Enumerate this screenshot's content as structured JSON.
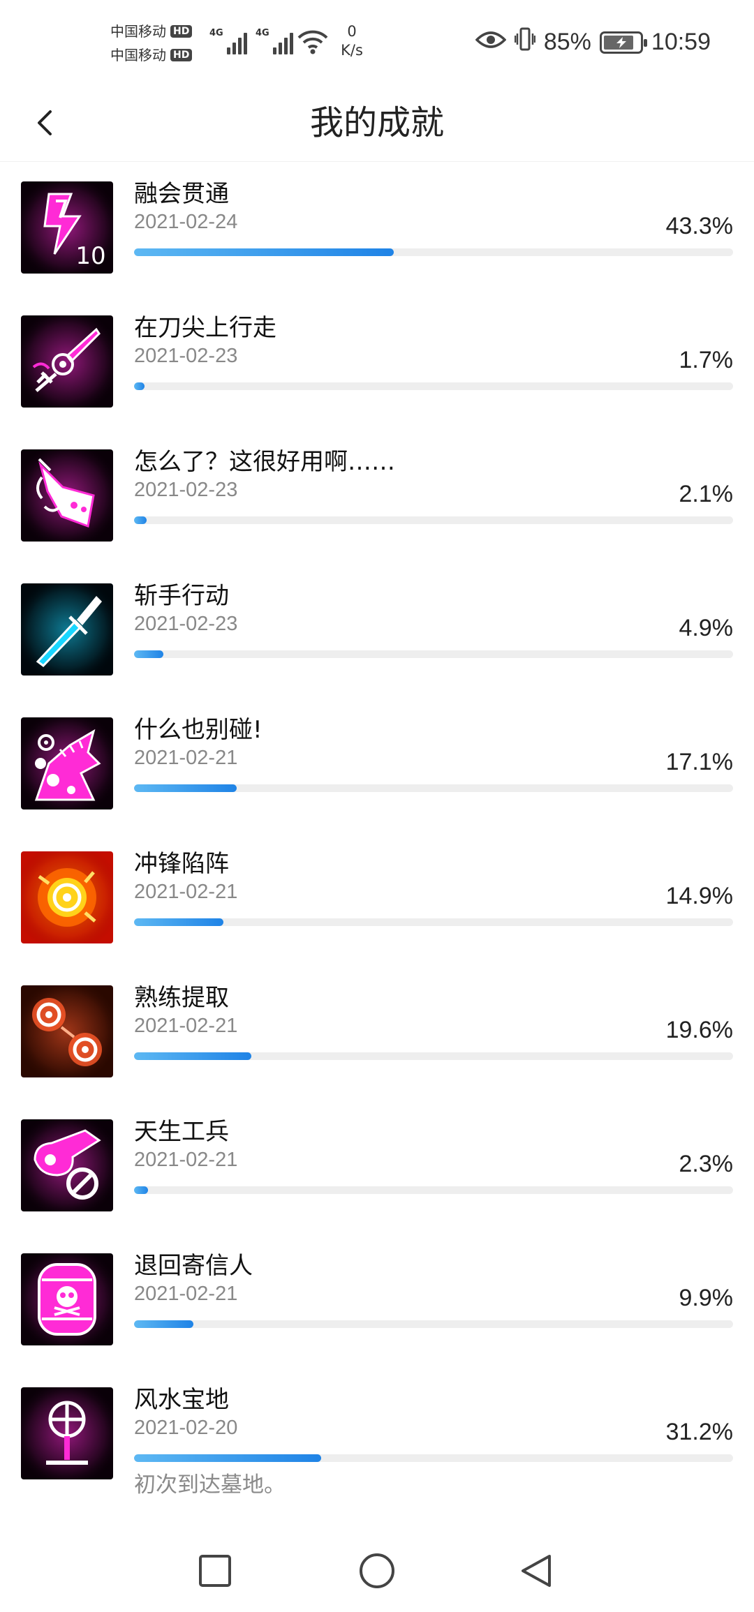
{
  "status_bar": {
    "carrier1": "中国移动",
    "carrier2": "中国移动",
    "hd": "HD",
    "net_tag": "4G",
    "speed_value": "0",
    "speed_unit": "K/s",
    "battery": "85%",
    "time": "10:59"
  },
  "header": {
    "title": "我的成就"
  },
  "achievements": [
    {
      "name": "融会贯通",
      "date": "2021-02-24",
      "percent_label": "43.3%",
      "progress": 0.433,
      "badge": "10",
      "icon": "lightning-icon",
      "color": "#ff2bd6"
    },
    {
      "name": "在刀尖上行走",
      "date": "2021-02-23",
      "percent_label": "1.7%",
      "progress": 0.017,
      "icon": "knife-rose-icon",
      "color": "#ff2bd6"
    },
    {
      "name": "怎么了？这很好用啊……",
      "date": "2021-02-23",
      "percent_label": "2.1%",
      "progress": 0.021,
      "icon": "blaster-icon",
      "color": "#ff2bd6"
    },
    {
      "name": "斩手行动",
      "date": "2021-02-23",
      "percent_label": "4.9%",
      "progress": 0.049,
      "icon": "blade-icon",
      "color": "#19d6ff"
    },
    {
      "name": "什么也别碰!",
      "date": "2021-02-21",
      "percent_label": "17.1%",
      "progress": 0.171,
      "icon": "creature-icon",
      "color": "#ff2bd6"
    },
    {
      "name": "冲锋陷阵",
      "date": "2021-02-21",
      "percent_label": "14.9%",
      "progress": 0.149,
      "icon": "fire-target-icon",
      "color": "#ffb400"
    },
    {
      "name": "熟练提取",
      "date": "2021-02-21",
      "percent_label": "19.6%",
      "progress": 0.196,
      "icon": "double-target-icon",
      "color": "#ff5a2b"
    },
    {
      "name": "天生工兵",
      "date": "2021-02-21",
      "percent_label": "2.3%",
      "progress": 0.023,
      "icon": "wrench-icon",
      "color": "#ff2bd6"
    },
    {
      "name": "退回寄信人",
      "date": "2021-02-21",
      "percent_label": "9.9%",
      "progress": 0.099,
      "icon": "skull-barrel-icon",
      "color": "#ff2bd6"
    },
    {
      "name": "风水宝地",
      "date": "2021-02-20",
      "percent_label": "31.2%",
      "progress": 0.312,
      "icon": "grave-cross-icon",
      "color": "#ff2bd6",
      "description": "初次到达墓地。"
    }
  ],
  "nav": {
    "recents": "square-icon",
    "home": "circle-icon",
    "back": "triangle-back-icon"
  }
}
